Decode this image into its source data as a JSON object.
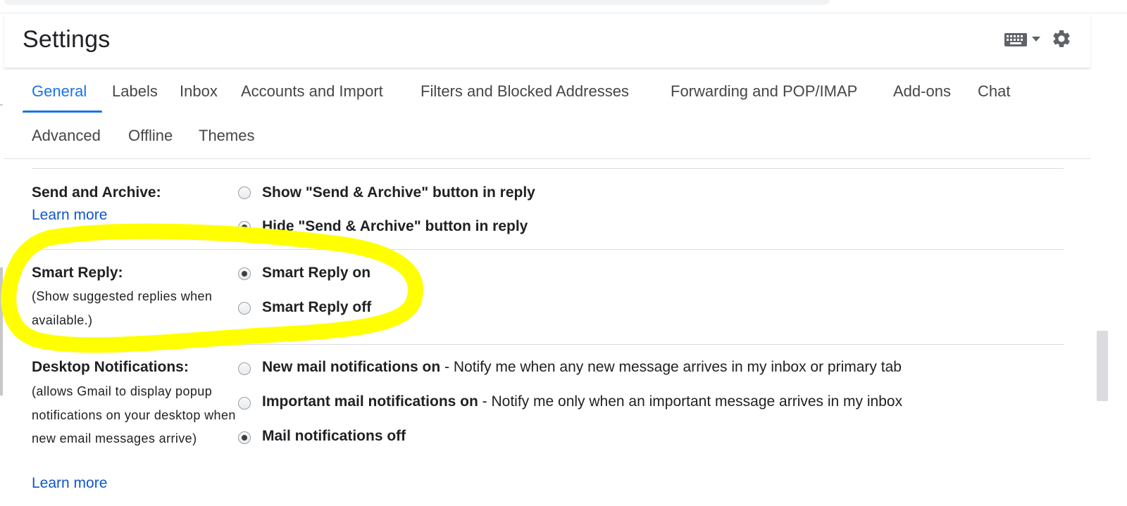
{
  "header": {
    "title": "Settings",
    "keyboard_icon": "keyboard-icon",
    "settings_icon": "gear-icon"
  },
  "tabs": [
    {
      "label": "General",
      "active": true
    },
    {
      "label": "Labels"
    },
    {
      "label": "Inbox"
    },
    {
      "label": "Accounts and Import"
    },
    {
      "label": "Filters and Blocked Addresses"
    },
    {
      "label": "Forwarding and POP/IMAP"
    },
    {
      "label": "Add-ons"
    },
    {
      "label": "Chat"
    },
    {
      "label": "Advanced"
    },
    {
      "label": "Offline"
    },
    {
      "label": "Themes"
    }
  ],
  "settings": {
    "send_archive": {
      "label": "Send and Archive:",
      "learn_more": "Learn more",
      "options": [
        {
          "text": "Show \"Send & Archive\" button in reply",
          "checked": false
        },
        {
          "text": "Hide \"Send & Archive\" button in reply",
          "checked": true
        }
      ]
    },
    "smart_reply": {
      "label": "Smart Reply:",
      "description": "(Show suggested replies when available.)",
      "options": [
        {
          "text": "Smart Reply on",
          "checked": true
        },
        {
          "text": "Smart Reply off",
          "checked": false
        }
      ]
    },
    "desktop_notifications": {
      "label": "Desktop Notifications:",
      "description": "(allows Gmail to display popup notifications on your desktop when new email messages arrive)",
      "learn_more": "Learn more",
      "options": [
        {
          "bold": "New mail notifications on",
          "rest": " - Notify me when any new message arrives in my inbox or primary tab",
          "checked": false
        },
        {
          "bold": "Important mail notifications on",
          "rest": " - Notify me only when an important message arrives in my inbox",
          "checked": false
        },
        {
          "bold": "Mail notifications off",
          "rest": "",
          "checked": true
        }
      ]
    }
  },
  "colors": {
    "accent": "#1a73e8",
    "link": "#1155cc",
    "highlight": "#ffff00"
  }
}
